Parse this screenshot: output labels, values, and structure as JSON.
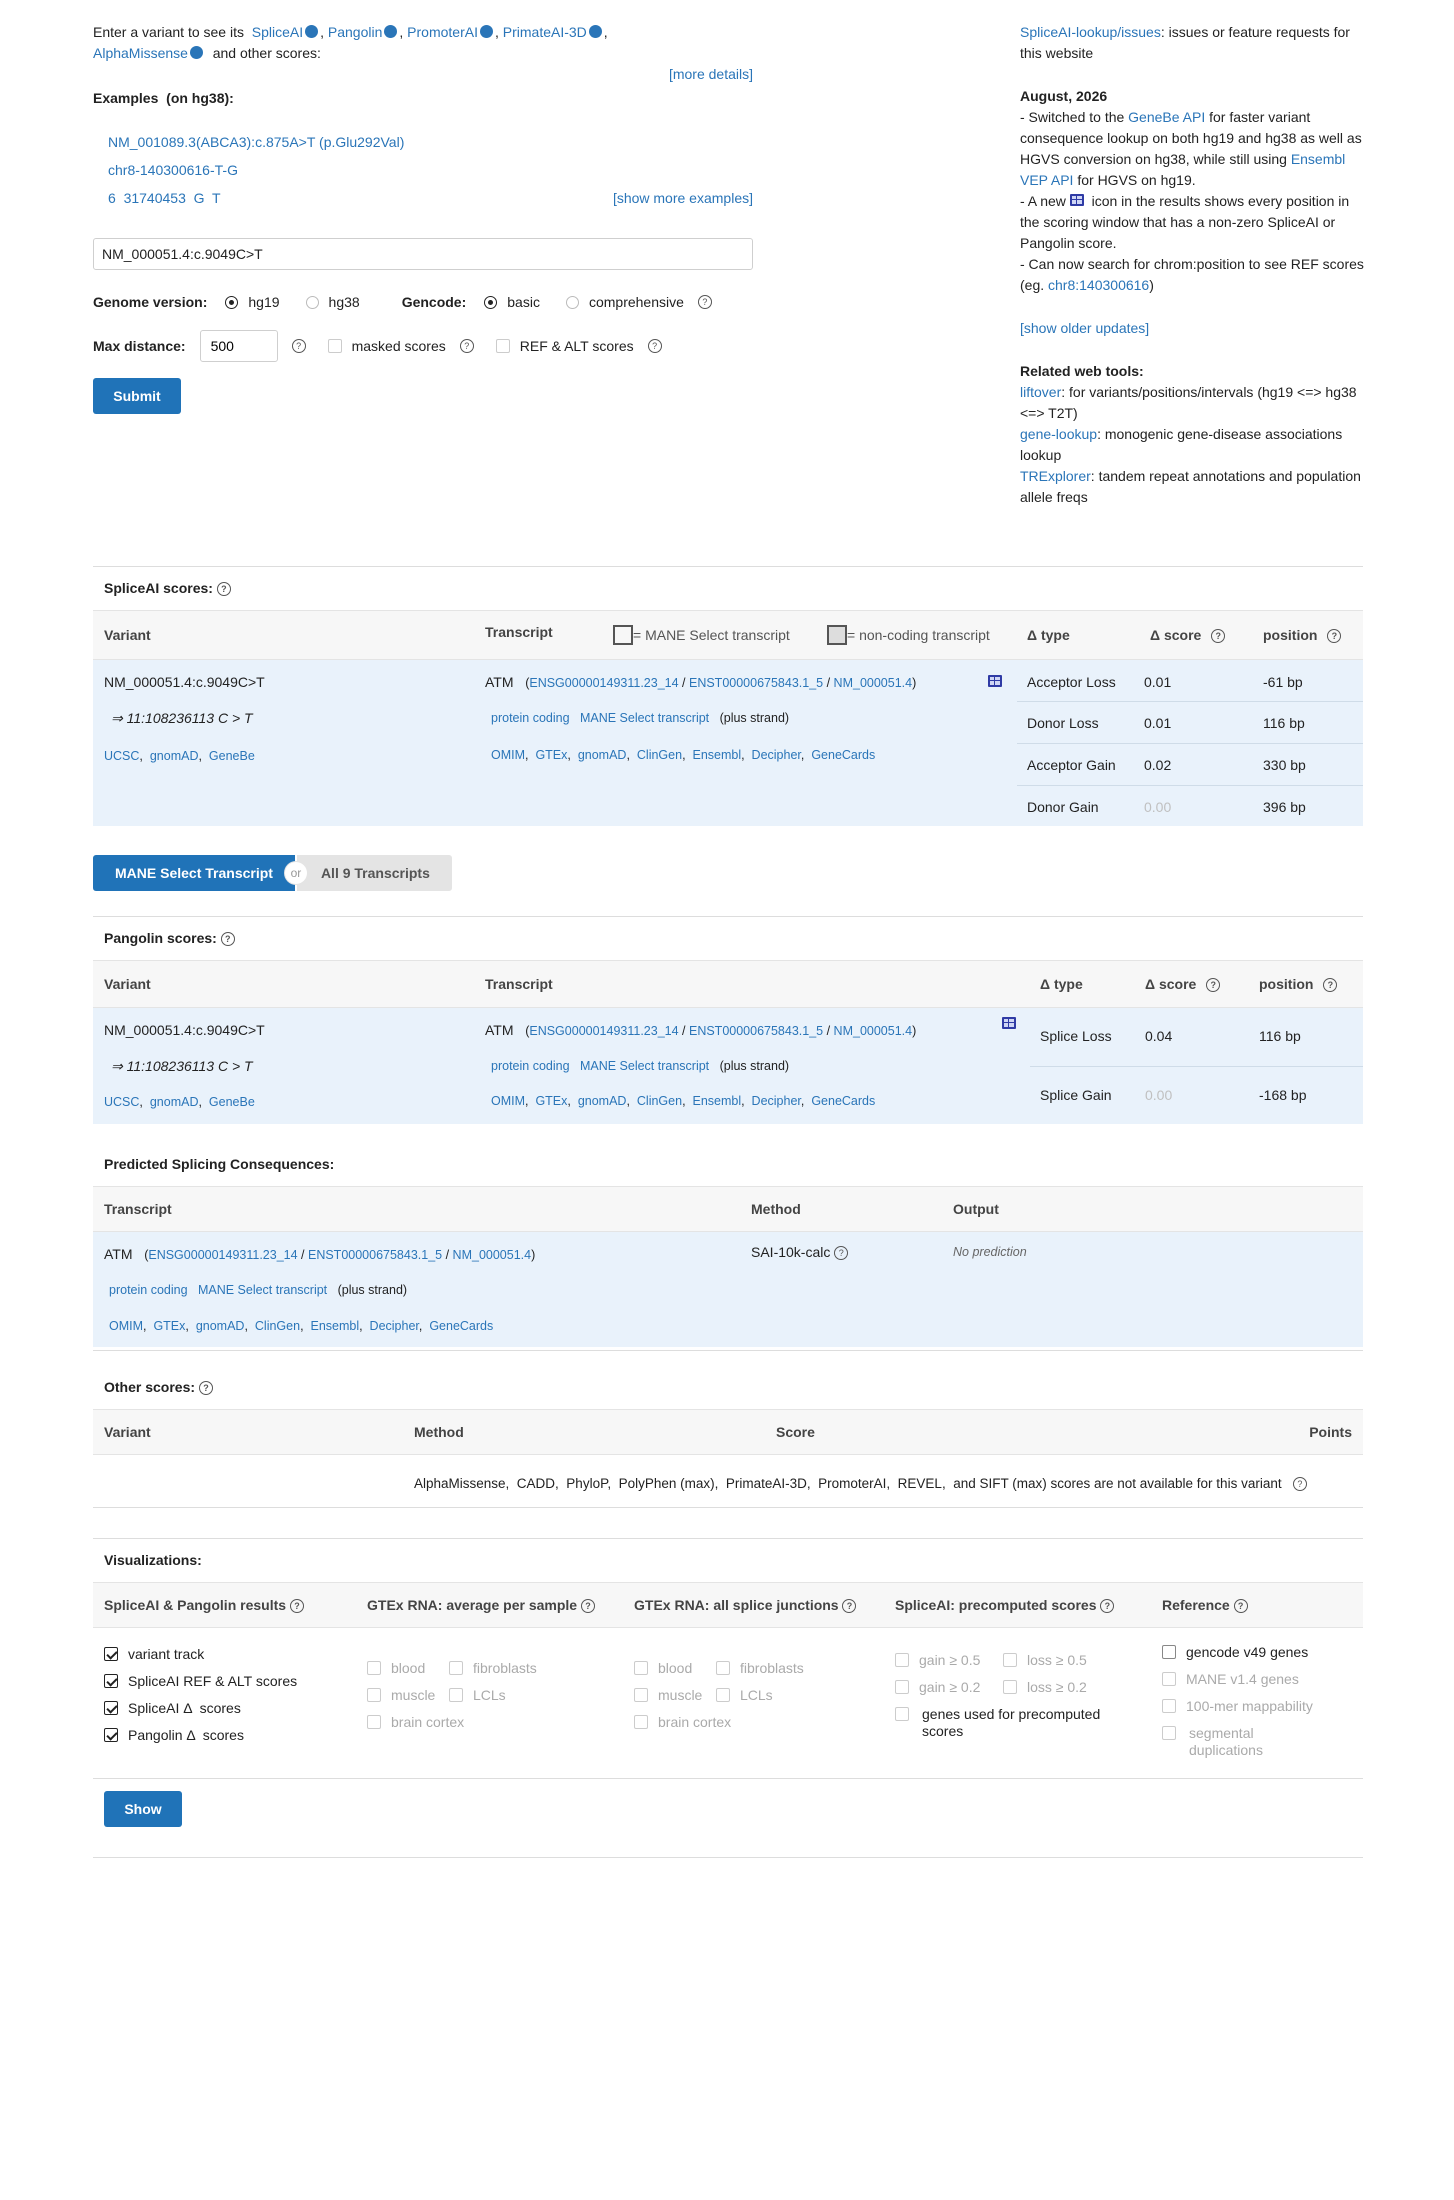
{
  "intro": {
    "prefix": "Enter a variant to see its",
    "tools": [
      "SpliceAI",
      "Pangolin",
      "PromoterAI",
      "PrimateAI-3D",
      "AlphaMissense"
    ],
    "suffix": "and other scores:",
    "more_details": "[more details]"
  },
  "examples": {
    "title": "Examples",
    "build": "(on hg38):",
    "items": [
      "NM_001089.3(ABCA3):c.875A>T (p.Glu292Val)",
      "chr8-140300616-T-G",
      "6  31740453  G  T"
    ],
    "show_more": "[show more examples]"
  },
  "search": {
    "value": "NM_000051.4:c.9049C>T"
  },
  "options": {
    "genome_label": "Genome version:",
    "genome_opts": [
      "hg19",
      "hg38"
    ],
    "gencode_label": "Gencode:",
    "gencode_opts": [
      "basic",
      "comprehensive"
    ],
    "maxdist_label": "Max distance:",
    "maxdist_value": "500",
    "masked": "masked scores",
    "refalt": "REF & ALT scores",
    "submit": "Submit"
  },
  "news": {
    "issues_link": "SpliceAI-lookup/issues",
    "issues_text": ": issues or feature requests for this website",
    "date": "August, 2026",
    "item1_a": "- Switched to the ",
    "item1_link1": "GeneBe API",
    "item1_b": " for faster variant consequence lookup on both hg19 and hg38 as well as HGVS conversion on hg38, while still using ",
    "item1_link2": "Ensembl VEP API",
    "item1_c": " for HGVS on hg19.",
    "item2_a": "- A new ",
    "item2_b": " icon in the results shows every position in the scoring window that has a non-zero SpliceAI or Pangolin score.",
    "item3_a": "- Can now search for chrom:position to see REF scores (eg. ",
    "item3_link": "chr8:140300616",
    "item3_b": ")",
    "older": "[show older updates]",
    "tools_title": "Related web tools:",
    "tool1_link": "liftover",
    "tool1_text": ": for variants/positions/intervals (hg19 <=> hg38 <=> T2T)",
    "tool2_link": "gene-lookup",
    "tool2_text": ": monogenic gene-disease associations lookup",
    "tool3_link": "TRExplorer",
    "tool3_text": ": tandem repeat annotations and population allele freqs"
  },
  "variant": {
    "name": "NM_000051.4:c.9049C>T",
    "hg19": "⇒ 11:108236113 C > T",
    "links": [
      "UCSC",
      "gnomAD",
      "GeneBe"
    ]
  },
  "transcript": {
    "gene": "ATM",
    "ids": [
      "ENSG00000149311.23_14",
      "ENST00000675843.1_5",
      "NM_000051.4"
    ],
    "type": "protein coding",
    "mane": "MANE Select transcript",
    "strand": "(plus strand)",
    "links": [
      "OMIM",
      "GTEx",
      "gnomAD",
      "ClinGen",
      "Ensembl",
      "Decipher",
      "GeneCards"
    ]
  },
  "spliceai": {
    "title": "SpliceAI scores:",
    "headers": {
      "variant": "Variant",
      "transcript": "Transcript",
      "mane_legend": "= MANE Select transcript",
      "noncoding_legend": "= non-coding transcript",
      "type": "Δ type",
      "score": "Δ score",
      "position": "position"
    },
    "rows": [
      {
        "type": "Acceptor Loss",
        "score": "0.01",
        "pos": "-61 bp"
      },
      {
        "type": "Donor Loss",
        "score": "0.01",
        "pos": "116 bp"
      },
      {
        "type": "Acceptor Gain",
        "score": "0.02",
        "pos": "330 bp"
      },
      {
        "type": "Donor Gain",
        "score": "0.00",
        "pos": "396 bp"
      }
    ]
  },
  "toggle": {
    "on": "MANE Select Transcript",
    "or": "or",
    "off": "All 9 Transcripts"
  },
  "pangolin": {
    "title": "Pangolin scores:",
    "headers": {
      "variant": "Variant",
      "transcript": "Transcript",
      "type": "Δ type",
      "score": "Δ score",
      "position": "position"
    },
    "rows": [
      {
        "type": "Splice Loss",
        "score": "0.04",
        "pos": "116 bp"
      },
      {
        "type": "Splice Gain",
        "score": "0.00",
        "pos": "-168 bp"
      }
    ]
  },
  "consequences": {
    "title": "Predicted Splicing Consequences:",
    "headers": {
      "transcript": "Transcript",
      "method": "Method",
      "output": "Output"
    },
    "method": "SAI-10k-calc",
    "output": "No prediction"
  },
  "other": {
    "title": "Other scores:",
    "headers": {
      "variant": "Variant",
      "method": "Method",
      "score": "Score",
      "points": "Points"
    },
    "note": "AlphaMissense,  CADD,  PhyloP,  PolyPhen (max),  PrimateAI-3D,  PromoterAI,  REVEL,  and SIFT (max) scores are not available for this variant"
  },
  "vis": {
    "title": "Visualizations:",
    "col1": {
      "head": "SpliceAI & Pangolin results",
      "items": [
        "variant track",
        "SpliceAI REF & ALT scores",
        "SpliceAI Δ  scores",
        "Pangolin Δ  scores"
      ]
    },
    "col2": {
      "head": "GTEx RNA: average per sample",
      "items": [
        "blood",
        "fibroblasts",
        "muscle",
        "LCLs",
        "brain cortex"
      ]
    },
    "col3": {
      "head": "GTEx RNA: all splice junctions",
      "items": [
        "blood",
        "fibroblasts",
        "muscle",
        "LCLs",
        "brain cortex"
      ]
    },
    "col4": {
      "head": "SpliceAI: precomputed scores",
      "items": [
        "gain ≥ 0.5",
        "loss ≥ 0.5",
        "gain ≥ 0.2",
        "loss ≥ 0.2",
        "genes used for precomputed scores"
      ]
    },
    "col5": {
      "head": "Reference",
      "items": [
        "gencode v49 genes",
        "MANE v1.4 genes",
        "100-mer mappability",
        "segmental duplications"
      ]
    },
    "show": "Show"
  },
  "colors": {
    "link": "#2a75b8",
    "button": "#2073b8",
    "row_bg": "#e9f2fb",
    "head_bg": "#f7f7f7"
  }
}
